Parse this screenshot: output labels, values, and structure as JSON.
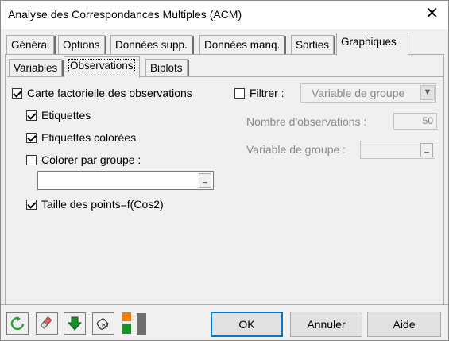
{
  "window": {
    "title": "Analyse des Correspondances Multiples (ACM)",
    "close_glyph": "✕"
  },
  "tabs": [
    {
      "label": "Général"
    },
    {
      "label": "Options"
    },
    {
      "label": "Données supp."
    },
    {
      "label": "Données manq."
    },
    {
      "label": "Sorties"
    },
    {
      "label": "Graphiques",
      "active": true
    }
  ],
  "subtabs": [
    {
      "label": "Variables"
    },
    {
      "label": "Observations",
      "active": true
    },
    {
      "label": "Biplots"
    }
  ],
  "options": {
    "carte_factorielle": {
      "label": "Carte factorielle des observations",
      "checked": true
    },
    "etiquettes": {
      "label": "Etiquettes",
      "checked": true
    },
    "etiquettes_colorees": {
      "label": "Etiquettes colorées",
      "checked": true
    },
    "colorer_par_groupe": {
      "label": "Colorer par groupe :",
      "checked": false,
      "value": ""
    },
    "taille_points": {
      "label": "Taille des points=f(Cos2)",
      "checked": true
    }
  },
  "filter": {
    "label": "Filtrer :",
    "checked": false,
    "select_value": "Variable de groupe",
    "nb_obs_label": "Nombre d'observations :",
    "nb_obs_value": "50",
    "variable_groupe_label": "Variable de groupe :"
  },
  "toolbar": {
    "icons": [
      "reset-icon",
      "eraser-icon",
      "download-icon",
      "select-icon",
      "color-icon"
    ]
  },
  "buttons": {
    "ok": "OK",
    "annuler": "Annuler",
    "aide": "Aide"
  },
  "colors": {
    "accent": "#0078d7",
    "reset": "#2e9e3e",
    "download": "#1a8f2b",
    "orange": "#f07d00"
  }
}
